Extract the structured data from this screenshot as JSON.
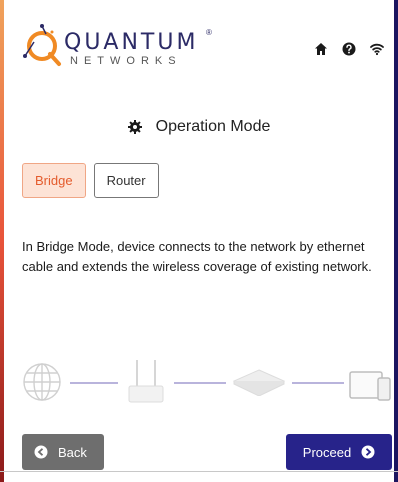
{
  "header": {
    "brand_name": "QUANTUM",
    "brand_reg": "®",
    "brand_sub": "NETWORKS",
    "icons": [
      "home-icon",
      "help-icon",
      "wifi-icon"
    ]
  },
  "page": {
    "title": "Operation Mode",
    "title_icon": "gear-icon"
  },
  "mode": {
    "options": [
      "Bridge",
      "Router"
    ],
    "selected": "Bridge"
  },
  "description": "In Bridge Mode, device connects to the network by ethernet cable and extends the wireless coverage of existing network.",
  "diagram": {
    "nodes": [
      "globe-icon",
      "router-icon",
      "access-point-icon",
      "devices-icon"
    ]
  },
  "footer": {
    "back_label": "Back",
    "proceed_label": "Proceed"
  },
  "colors": {
    "brand_navy": "#2b2a66",
    "accent_orange": "#e45b2c",
    "selected_bg": "#fde3d6",
    "proceed_bg": "#27238a",
    "back_bg": "#6e6e6e",
    "link_line": "#b9b4dc"
  }
}
